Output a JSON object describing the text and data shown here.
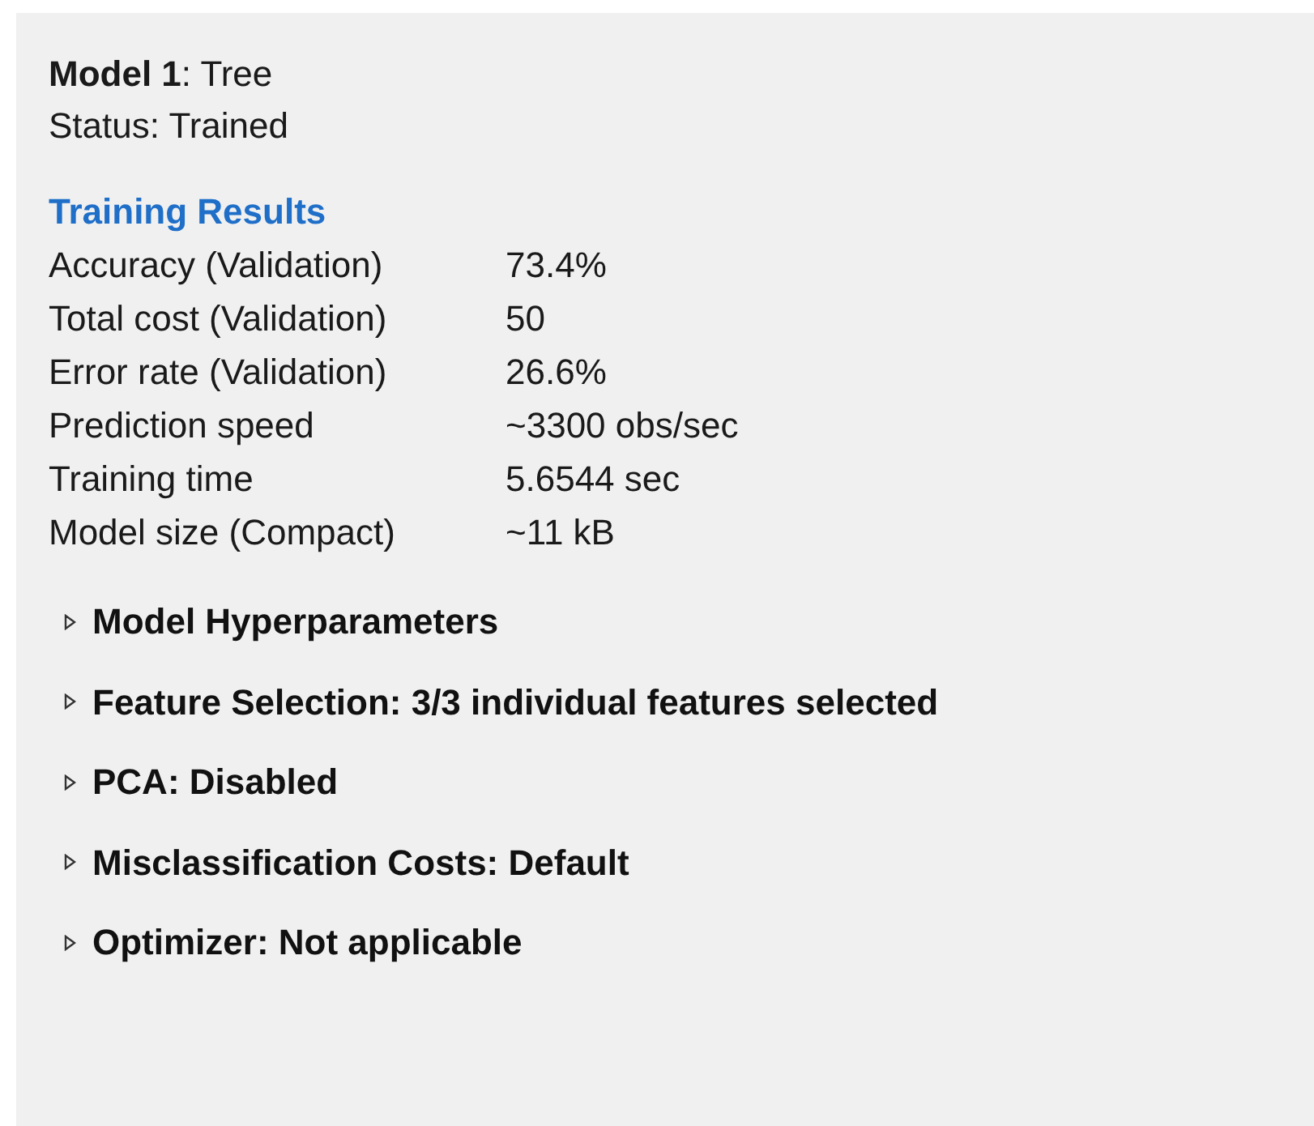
{
  "model": {
    "title": "**Model 1**: Tree",
    "status": "Status: Trained"
  },
  "training_results": {
    "heading": "Training Results",
    "rows": [
      {
        "label": "Accuracy (Validation)",
        "value": "73.4%"
      },
      {
        "label": "Total cost (Validation)",
        "value": "50"
      },
      {
        "label": "Error rate (Validation)",
        "value": "26.6%"
      },
      {
        "label": "Prediction speed",
        "value": "~3300 obs/sec"
      },
      {
        "label": "Training time",
        "value": "5.6544 sec"
      },
      {
        "label": "Model size (Compact)",
        "value": "~11 kB"
      }
    ]
  },
  "sections": [
    {
      "label": "Model Hyperparameters",
      "expanded": false
    },
    {
      "label": "Feature Selection: 3/3 individual features selected",
      "expanded": false
    },
    {
      "label": "PCA: Disabled",
      "expanded": false
    },
    {
      "label": "Misclassification Costs: Default",
      "expanded": false
    },
    {
      "label": "Optimizer: Not applicable",
      "expanded": false
    }
  ]
}
